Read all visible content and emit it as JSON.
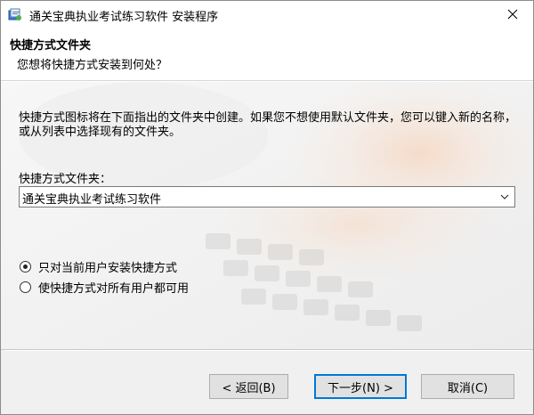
{
  "window": {
    "title": "通关宝典执业考试练习软件 安装程序"
  },
  "header": {
    "title": "快捷方式文件夹",
    "subtitle": "您想将快捷方式安装到何处？"
  },
  "main": {
    "description": "快捷方式图标将在下面指出的文件夹中创建。如果您不想使用默认文件夹，您可以键入新的名称，或从列表中选择现有的文件夹。",
    "folder_label": "快捷方式文件夹：",
    "folder_value": "通关宝典执业考试练习软件",
    "options": [
      {
        "label": "只对当前用户安装快捷方式",
        "checked": true
      },
      {
        "label": "使快捷方式对所有用户都可用",
        "checked": false
      }
    ]
  },
  "footer": {
    "back_label": "< 返回(B)",
    "next_label": "下一步(N) >",
    "cancel_label": "取消(C)"
  },
  "icons": {
    "app": "installer-icon",
    "close": "close-icon",
    "dropdown": "chevron-down-icon"
  },
  "colors": {
    "focus_border": "#0078d7",
    "button_face": "#e1e1e1",
    "footer_bg": "#f0f0f0"
  }
}
